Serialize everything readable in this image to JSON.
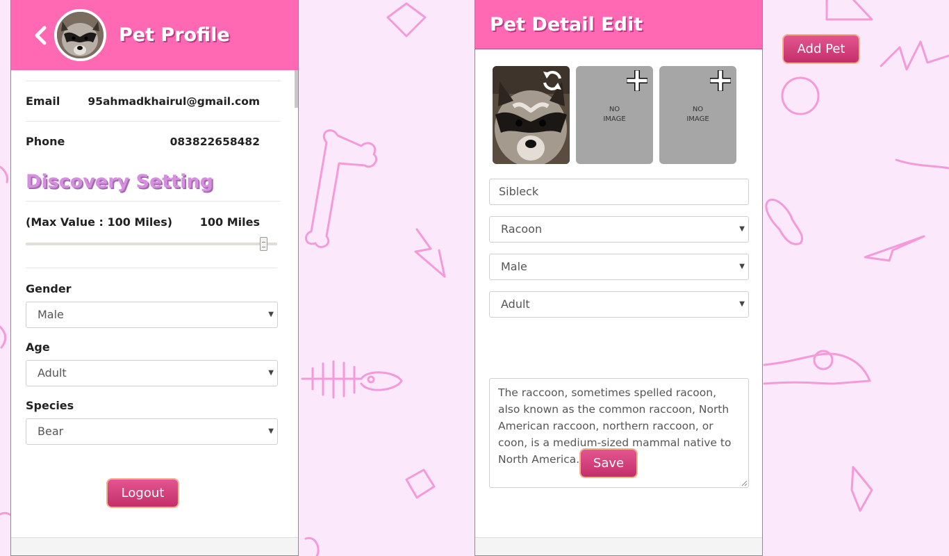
{
  "profile_panel": {
    "title": "Pet Profile",
    "email_label": "Email",
    "email_value": "95ahmadkhairul@gmail.com",
    "phone_label": "Phone",
    "phone_value": "083822658482",
    "discovery_title": "Discovery Setting",
    "max_value_label": "(Max Value : 100 Miles)",
    "distance_value": "100 Miles",
    "distance_slider_fraction": 1.0,
    "gender_label": "Gender",
    "gender_value": "Male",
    "age_label": "Age",
    "age_value": "Adult",
    "species_label": "Species",
    "species_value": "Bear",
    "logout_label": "Logout"
  },
  "edit_panel": {
    "title": "Pet Detail Edit",
    "no_image_line1": "NO",
    "no_image_line2": "IMAGE",
    "name_value": "Sibleck",
    "species_value": "Racoon",
    "gender_value": "Male",
    "age_value": "Adult",
    "description": "The raccoon, sometimes spelled racoon, also known as the common raccoon, North American raccoon, northern raccoon, or coon, is a medium-sized mammal native to North America.",
    "save_label": "Save"
  },
  "add_pet_label": "Add Pet",
  "colors": {
    "header_pink": "#ff69b4",
    "background": "#fce8fb",
    "button_gradient_top": "#e3568f",
    "button_gradient_bottom": "#c42f6a",
    "doodle_stroke": "#f59ad8"
  },
  "icons": [
    "back-chevron-icon",
    "refresh-icon",
    "add-photo-icon",
    "dropdown-arrow-icon"
  ]
}
